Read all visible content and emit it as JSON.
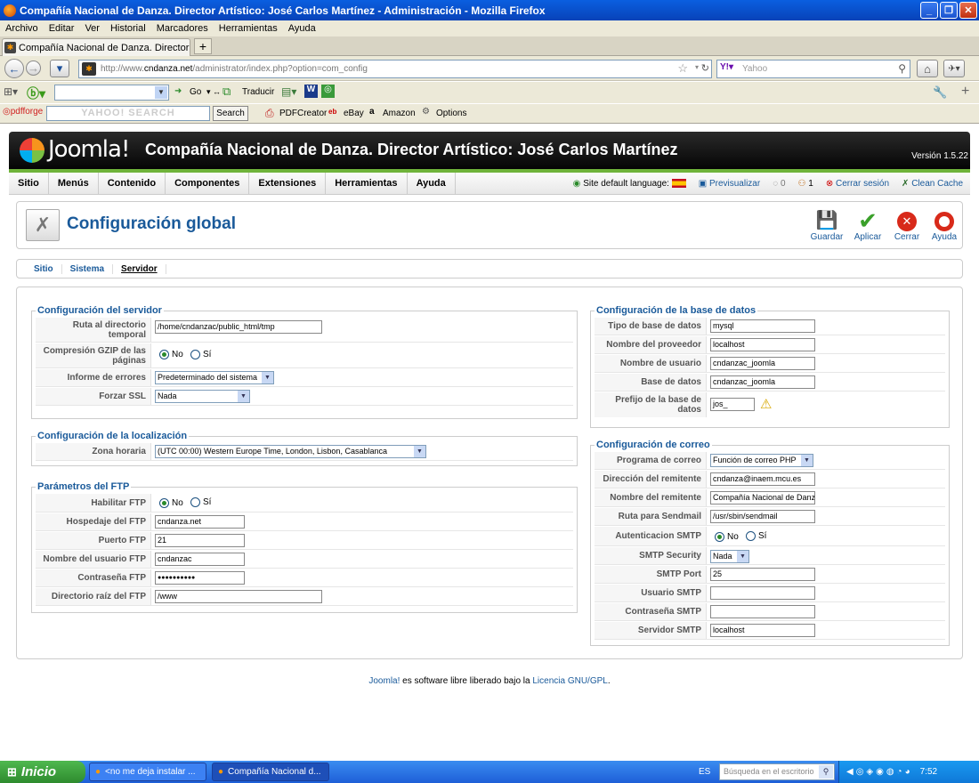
{
  "browser": {
    "window_title": "Compañía Nacional de Danza. Director Artístico: José Carlos Martínez - Administración - Mozilla Firefox",
    "menu": [
      "Archivo",
      "Editar",
      "Ver",
      "Historial",
      "Marcadores",
      "Herramientas",
      "Ayuda"
    ],
    "tab_title": "Compañía Nacional de Danza. Director Artísti...",
    "url_prefix": "http://www.",
    "url_domain": "cndanza.net",
    "url_path": "/administrator/index.php?option=com_config",
    "search_placeholder": "Yahoo",
    "toolbar2": {
      "go": "Go",
      "traducir": "Traducir"
    },
    "toolbar3": {
      "pdfforge": "pdfforge",
      "yahoo_box": "YAHOO! SEARCH",
      "search_btn": "Search",
      "pdfcreator": "PDFCreator",
      "ebay": "eBay",
      "amazon": "Amazon",
      "options": "Options"
    }
  },
  "joomla": {
    "logo": "Joomla!",
    "site_title": "Compañía Nacional de Danza. Director Artístico: José Carlos Martínez",
    "version": "Versión 1.5.22",
    "menu": [
      "Sitio",
      "Menús",
      "Contenido",
      "Componentes",
      "Extensiones",
      "Herramientas",
      "Ayuda"
    ],
    "status": {
      "language": "Site default language:",
      "preview": "Previsualizar",
      "messages": "0",
      "users": "1",
      "logout": "Cerrar sesión",
      "clean_cache": "Clean Cache"
    },
    "page_title": "Configuración global",
    "toolbar": {
      "save": "Guardar",
      "apply": "Aplicar",
      "close": "Cerrar",
      "help": "Ayuda"
    },
    "subtabs": [
      "Sitio",
      "Sistema",
      "Servidor"
    ],
    "active_subtab": "Servidor",
    "footer": {
      "joomla": "Joomla!",
      "text": " es software libre liberado bajo la ",
      "license": "Licencia GNU/GPL",
      "end": "."
    }
  },
  "server": {
    "legend": "Configuración del servidor",
    "tmp_label": "Ruta al directorio temporal",
    "tmp_value": "/home/cndanzac/public_html/tmp",
    "gzip_label": "Compresión GZIP de las páginas",
    "gzip_no": "No",
    "gzip_yes": "Sí",
    "errors_label": "Informe de errores",
    "errors_value": "Predeterminado del sistema",
    "ssl_label": "Forzar SSL",
    "ssl_value": "Nada"
  },
  "locale": {
    "legend": "Configuración de la localización",
    "tz_label": "Zona horaria",
    "tz_value": "(UTC 00:00) Western Europe Time, London, Lisbon, Casablanca"
  },
  "ftp": {
    "legend": "Parámetros del FTP",
    "enable_label": "Habilitar FTP",
    "enable_no": "No",
    "enable_yes": "Sí",
    "host_label": "Hospedaje del FTP",
    "host_value": "cndanza.net",
    "port_label": "Puerto FTP",
    "port_value": "21",
    "user_label": "Nombre del usuario FTP",
    "user_value": "cndanzac",
    "pass_label": "Contraseña FTP",
    "pass_value": "●●●●●●●●●●",
    "root_label": "Directorio raíz del FTP",
    "root_value": "/www"
  },
  "db": {
    "legend": "Configuración de la base de datos",
    "type_label": "Tipo de base de datos",
    "type_value": "mysql",
    "host_label": "Nombre del proveedor",
    "host_value": "localhost",
    "user_label": "Nombre de usuario",
    "user_value": "cndanzac_joomla",
    "name_label": "Base de datos",
    "name_value": "cndanzac_joomla",
    "prefix_label": "Prefijo de la base de datos",
    "prefix_value": "jos_"
  },
  "mail": {
    "legend": "Configuración de correo",
    "mailer_label": "Programa de correo",
    "mailer_value": "Función de correo PHP",
    "from_label": "Dirección del remitente",
    "from_value": "cndanza@inaem.mcu.es",
    "fromname_label": "Nombre del remitente",
    "fromname_value": "Compañía Nacional de Danza",
    "sendmail_label": "Ruta para Sendmail",
    "sendmail_value": "/usr/sbin/sendmail",
    "smtpauth_label": "Autenticacion SMTP",
    "smtpauth_no": "No",
    "smtpauth_yes": "Sí",
    "smtpsec_label": "SMTP Security",
    "smtpsec_value": "Nada",
    "smtpport_label": "SMTP Port",
    "smtpport_value": "25",
    "smtpuser_label": "Usuario SMTP",
    "smtpuser_value": "",
    "smtppass_label": "Contraseña SMTP",
    "smtppass_value": "",
    "smtphost_label": "Servidor SMTP",
    "smtphost_value": "localhost"
  },
  "taskbar": {
    "start": "Inicio",
    "task1": "<no me deja instalar ...",
    "task2": "Compañía Nacional d...",
    "lang": "ES",
    "desktop_search": "Búsqueda en el escritorio",
    "clock": "7:52"
  }
}
